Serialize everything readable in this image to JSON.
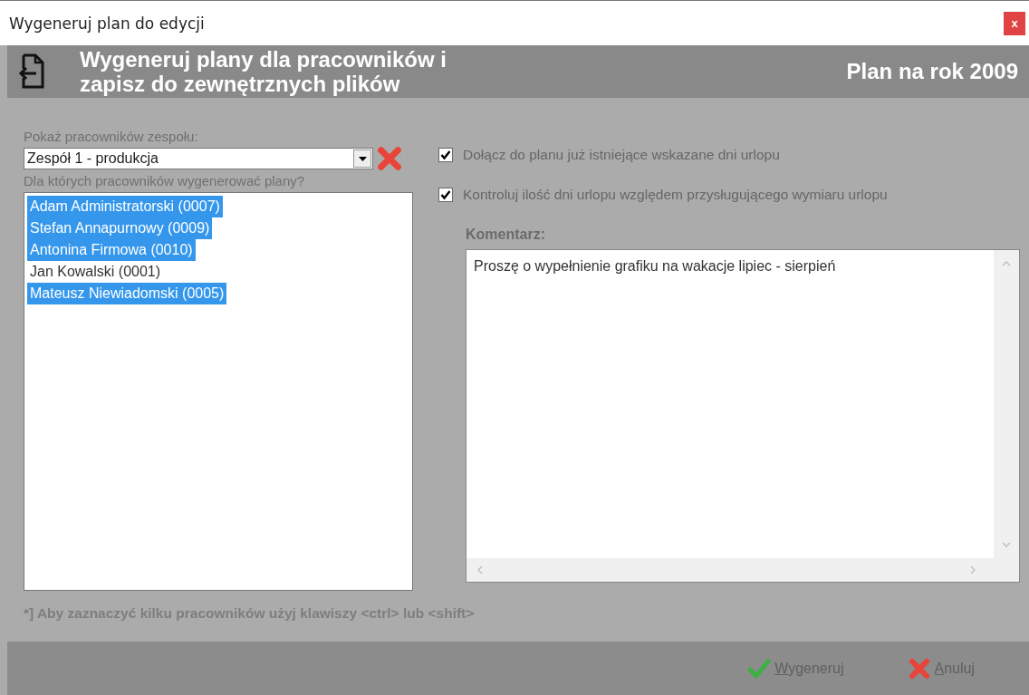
{
  "window": {
    "title": "Wygeneruj plan do edycji",
    "close": "x"
  },
  "header": {
    "title": "Wygeneruj plany dla pracowników i zapisz do zewnętrznych plików",
    "plan_year": "Plan na rok 2009"
  },
  "team": {
    "label": "Pokaż pracowników zespołu:",
    "value": "Zespół 1 - produkcja"
  },
  "employees": {
    "label": "Dla których pracowników wygenerować plany?",
    "items": [
      {
        "name": "Adam Administratorski (0007)",
        "selected": true
      },
      {
        "name": "Stefan Annapurnowy (0009)",
        "selected": true
      },
      {
        "name": "Antonina Firmowa (0010)",
        "selected": true
      },
      {
        "name": "Jan Kowalski (0001)",
        "selected": false
      },
      {
        "name": "Mateusz Niewiadomski (0005)",
        "selected": true
      }
    ]
  },
  "options": [
    {
      "label": "Dołącz do planu już istniejące wskazane dni urlopu",
      "checked": true
    },
    {
      "label": "Kontroluj ilość dni urlopu względem przysługującego wymiaru urlopu",
      "checked": true
    }
  ],
  "comment": {
    "label": "Komentarz:",
    "value": "Proszę o wypełnienie grafiku na wakacje lipiec - sierpień"
  },
  "hint": "*] Aby zaznaczyć kilku pracowników użyj klawiszy <ctrl> lub <shift>",
  "buttons": [
    {
      "kind": "ok",
      "label": "Wygeneruj",
      "mnemonic_underlined": true
    },
    {
      "kind": "cancel",
      "label": "Anuluj",
      "mnemonic_underlined": true
    }
  ]
}
